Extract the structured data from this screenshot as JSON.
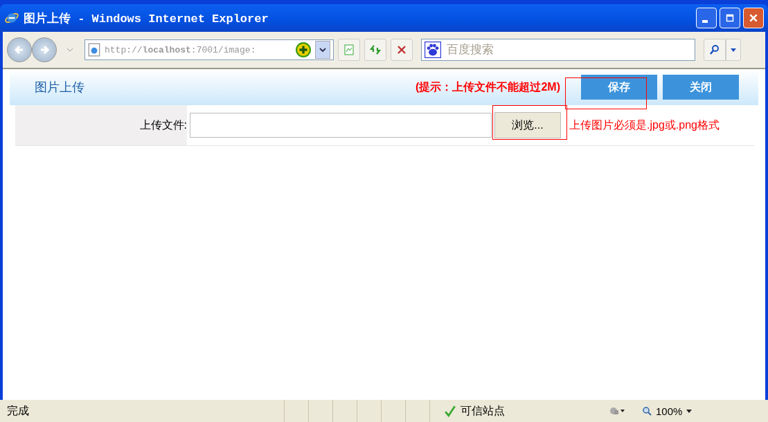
{
  "window": {
    "title": "图片上传 - Windows Internet Explorer"
  },
  "address_bar": {
    "url": "http://**localhost**:7001/image:"
  },
  "search": {
    "placeholder": "百度搜索"
  },
  "page": {
    "heading": "图片上传",
    "hint": "(提示：上传文件不能超过2M)",
    "buttons": [
      "保存",
      "关闭"
    ],
    "form": {
      "label": "上传文件:",
      "browse_button": "浏览...",
      "note": "上传图片必须是.jpg或.png格式"
    }
  },
  "status_bar": {
    "text": "完成",
    "zone": "可信站点",
    "zoom": "100%"
  }
}
